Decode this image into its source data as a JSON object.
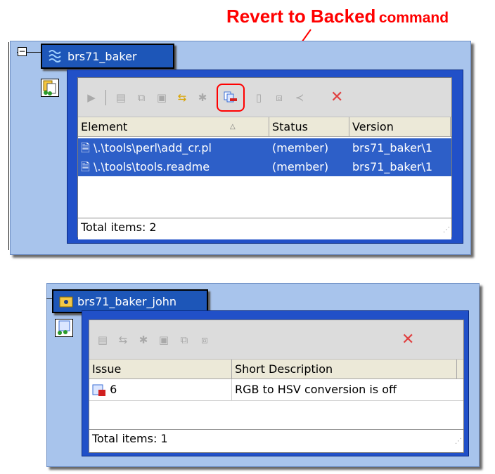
{
  "callout": {
    "big": "Revert to Backed",
    "small": "command"
  },
  "top": {
    "stream_name": "brs71_baker",
    "expander": "−",
    "columns": [
      "Element",
      "Status",
      "Version"
    ],
    "rows": [
      {
        "element": "\\.\\tools\\perl\\add_cr.pl",
        "status": "(member)",
        "version": "brs71_baker\\1"
      },
      {
        "element": "\\.\\tools\\tools.readme",
        "status": "(member)",
        "version": "brs71_baker\\1"
      }
    ],
    "footer": "Total items: 2"
  },
  "bottom": {
    "stream_name": "brs71_baker_john",
    "columns": [
      "Issue",
      "Short Description"
    ],
    "rows": [
      {
        "issue": "6",
        "description": "RGB to HSV conversion is off"
      }
    ],
    "footer": "Total items: 1"
  },
  "colors": {
    "accent": "#2150c8",
    "selection": "#2d5fc8",
    "callout": "#ff0000",
    "panel": "#a8c4ec"
  }
}
